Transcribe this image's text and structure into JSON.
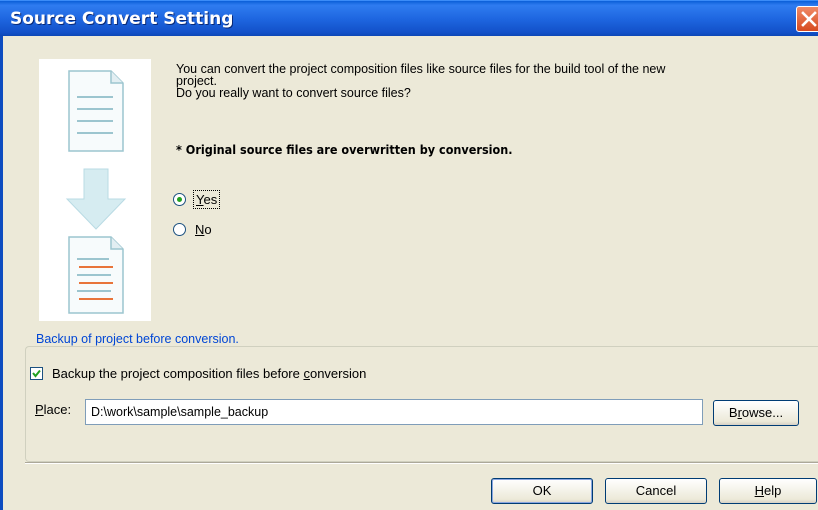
{
  "window": {
    "title": "Source Convert Setting"
  },
  "message": {
    "line1": "You can convert the project composition files like source files for the build tool of the new",
    "line2": "project.",
    "line3": "Do you really want to convert source files?",
    "warning": "* Original source files are overwritten by conversion."
  },
  "options": {
    "yes": {
      "prefix": "",
      "underlined": "Y",
      "rest": "es",
      "checked": true
    },
    "no": {
      "prefix": "",
      "underlined": "N",
      "rest": "o",
      "checked": false
    }
  },
  "backup": {
    "group_title": "Backup of project before conversion.",
    "checkbox_prefix": "Backup the project composition files before ",
    "checkbox_underlined": "c",
    "checkbox_rest": "onversion",
    "checked": true,
    "place_label_underlined": "P",
    "place_label_rest": "lace:",
    "place_value": "D:\\work\\sample\\sample_backup",
    "browse_prefix": "B",
    "browse_underlined": "r",
    "browse_rest": "owse..."
  },
  "buttons": {
    "ok": "OK",
    "cancel": "Cancel",
    "help_underlined": "H",
    "help_rest": "elp"
  },
  "colors": {
    "titlebar": "#1e66e0",
    "group_title": "#0046d5",
    "dialog_bg": "#ece9d8"
  }
}
